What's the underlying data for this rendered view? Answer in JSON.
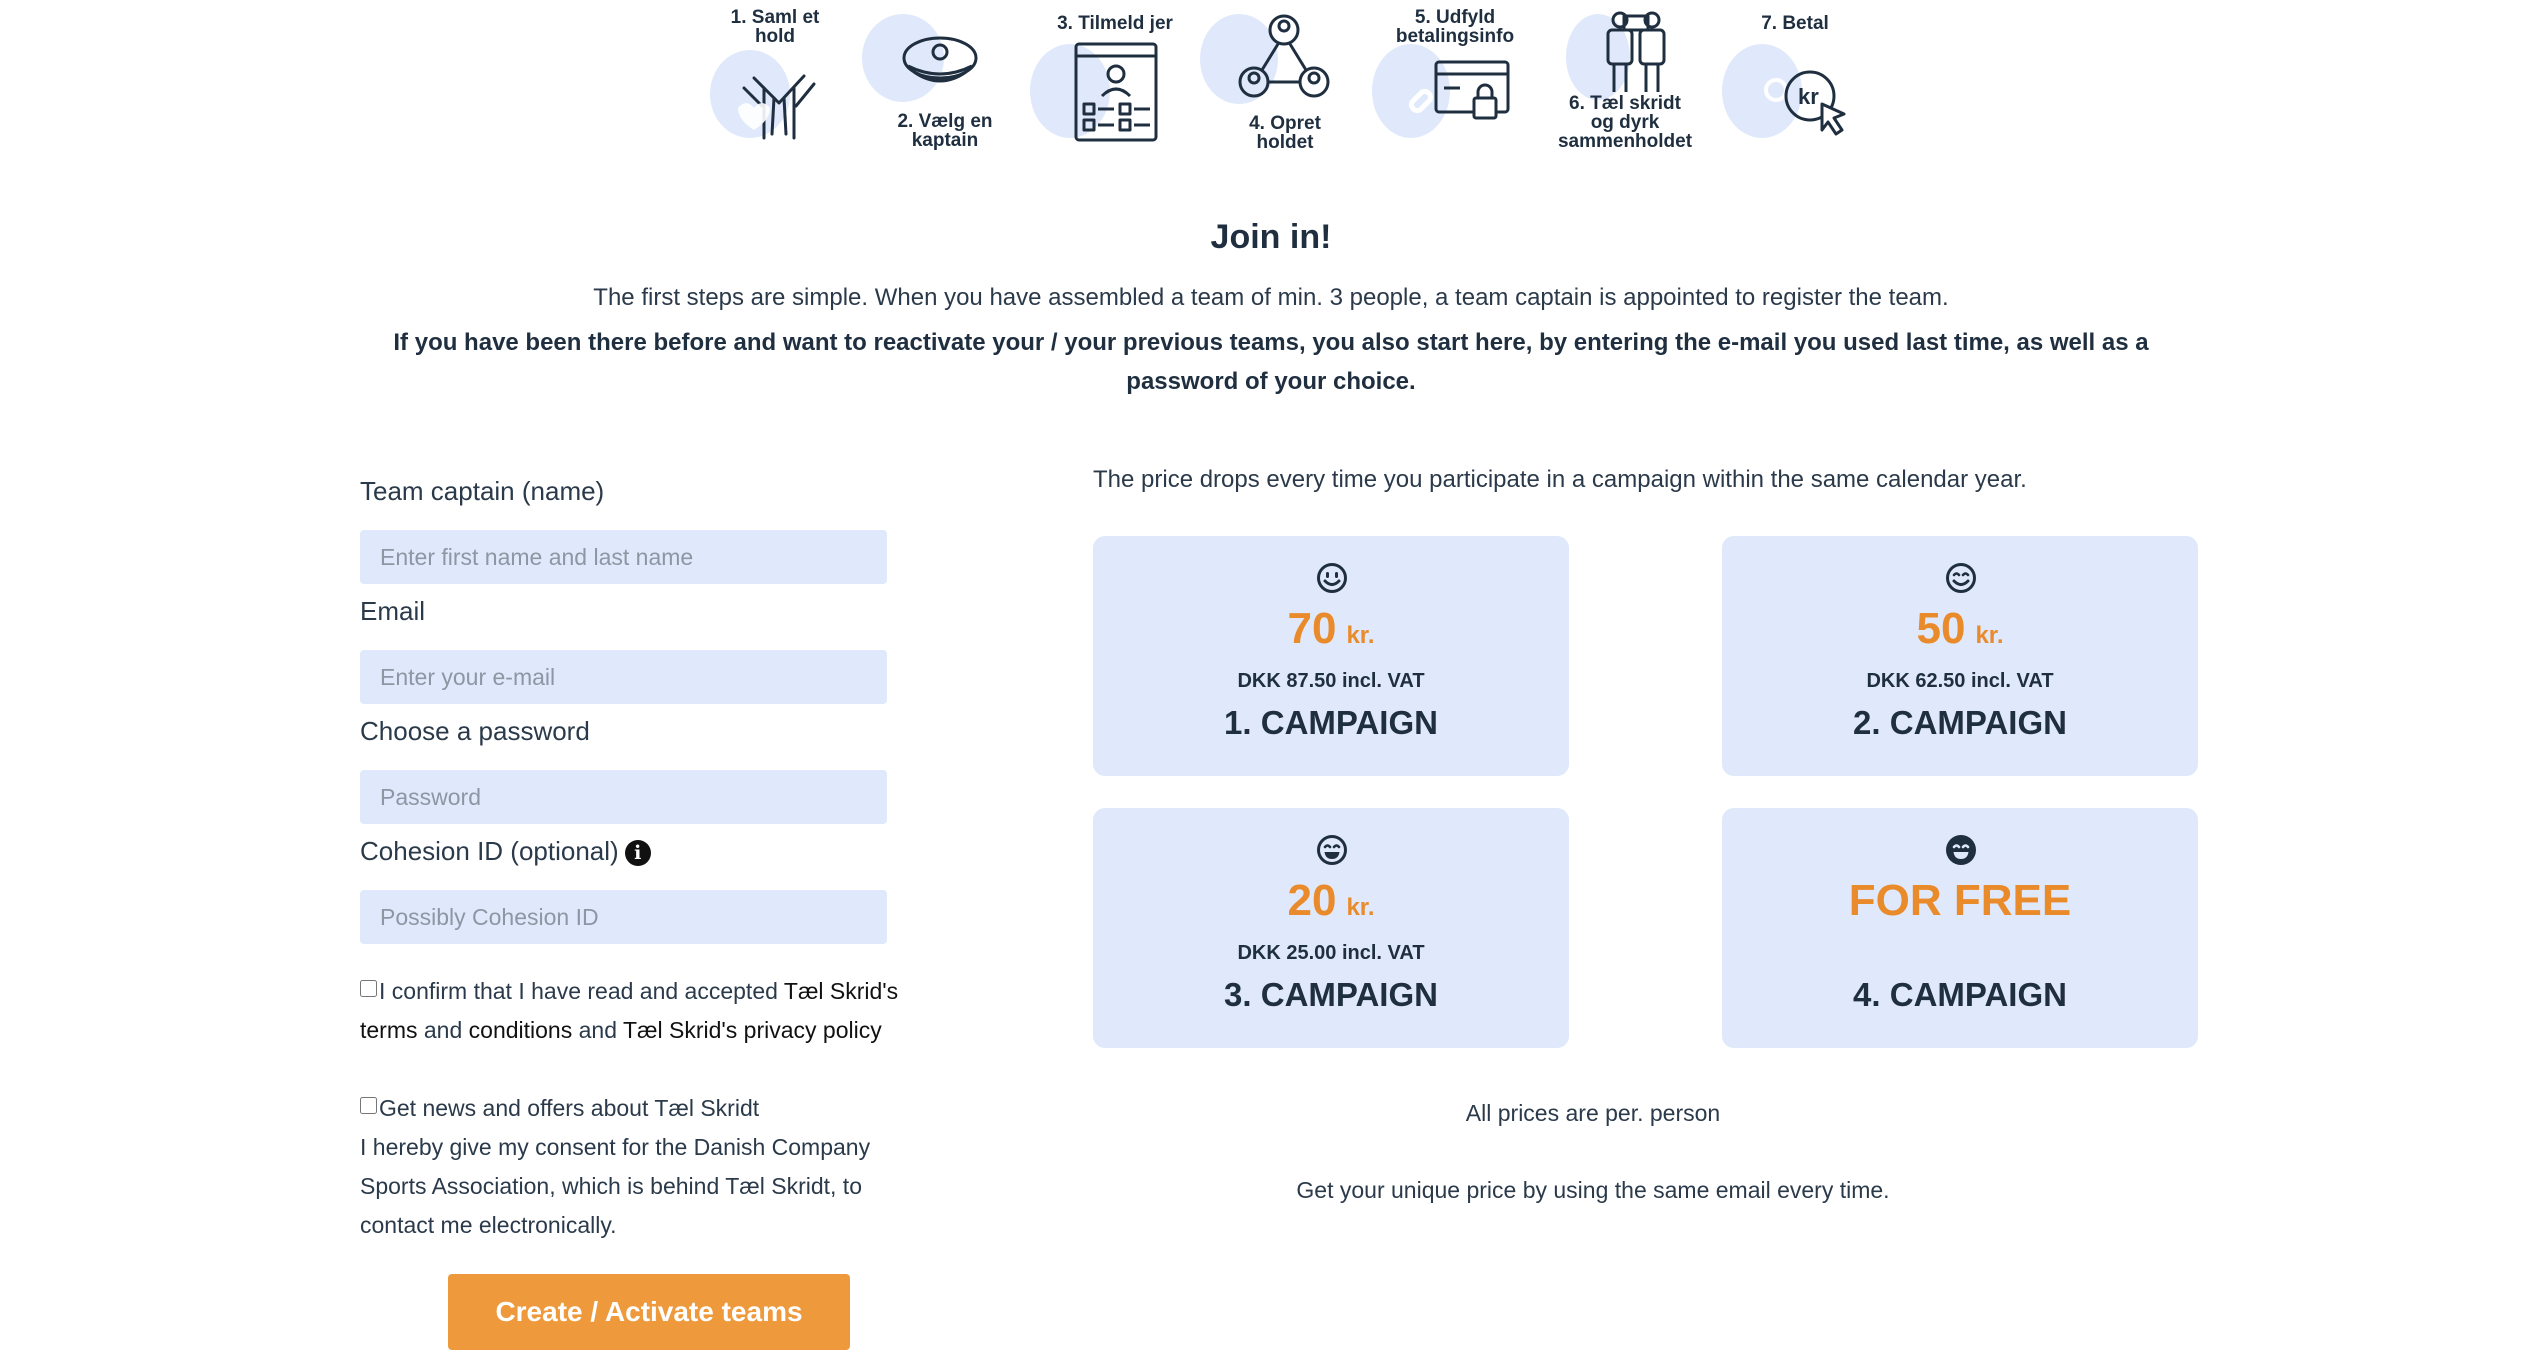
{
  "steps": [
    {
      "label_line1": "1. Saml et",
      "label_line2": "hold",
      "icon": "joined-hands-icon"
    },
    {
      "label_line1": "2. Vælg en",
      "label_line2": "kaptain",
      "icon": "captain-hat-icon"
    },
    {
      "label_line1": "3. Tilmeld jer",
      "label_line2": "",
      "icon": "registration-form-icon"
    },
    {
      "label_line1": "4. Opret",
      "label_line2": "holdet",
      "icon": "team-network-icon"
    },
    {
      "label_line1": "5. Udfyld",
      "label_line2": "betalingsinfo",
      "icon": "payment-card-lock-icon"
    },
    {
      "label_line1": "6. Tæl skridt",
      "label_line2": "og dyrk",
      "label_line3": "sammenholdet",
      "icon": "walking-people-icon"
    },
    {
      "label_line1": "7. Betal",
      "label_line2": "",
      "icon": "kr-cursor-icon"
    }
  ],
  "intro": {
    "title": "Join in!",
    "text": "The first steps are simple. When you have assembled a team of min. 3 people, a team captain is appointed to register the team.",
    "bold_text": "If you have been there before and want to reactivate your / your previous teams, you also start here, by entering the e-mail you used last time, as well as a password of your choice."
  },
  "form": {
    "captain_label": "Team captain (name)",
    "captain_placeholder": "Enter first name and last name",
    "email_label": "Email",
    "email_placeholder": "Enter your e-mail",
    "password_label": "Choose a password",
    "password_placeholder": "Password",
    "cohesion_label": "Cohesion ID (optional)",
    "cohesion_placeholder": "Possibly Cohesion ID",
    "terms": {
      "prefix": "I confirm that I have read and accepted ",
      "terms_link": "Tæl Skrid's terms",
      "and1": " and ",
      "conditions_link": "conditions",
      "and2": " and ",
      "privacy_link": "Tæl Skrid's privacy policy"
    },
    "news_label": "Get news and offers about Tæl Skridt",
    "consent_text": "I hereby give my consent for the Danish Company Sports Association, which is behind Tæl Skridt, to contact me electronically.",
    "submit_label": "Create / Activate teams"
  },
  "pricing": {
    "note": "The price drops every time you participate in a campaign within the same calendar year.",
    "cards": [
      {
        "amount": "70",
        "unit": "kr.",
        "vat": "DKK 87.50 incl. VAT",
        "campaign": "1. CAMPAIGN",
        "icon": "smiley-icon"
      },
      {
        "amount": "50",
        "unit": "kr.",
        "vat": "DKK 62.50 incl. VAT",
        "campaign": "2. CAMPAIGN",
        "icon": "smile-icon"
      },
      {
        "amount": "20",
        "unit": "kr.",
        "vat": "DKK 25.00 incl. VAT",
        "campaign": "3. CAMPAIGN",
        "icon": "grin-icon"
      },
      {
        "free": "FOR FREE",
        "campaign": "4. CAMPAIGN",
        "icon": "happy-face-icon"
      }
    ],
    "per_person": "All prices are per. person",
    "unique_price": "Get your unique price by using the same email every time."
  },
  "colors": {
    "accent": "#ee9a3c",
    "price_orange": "#e98a2b",
    "card_bg": "#dfe9fb",
    "text_dark": "#1f2f40"
  }
}
